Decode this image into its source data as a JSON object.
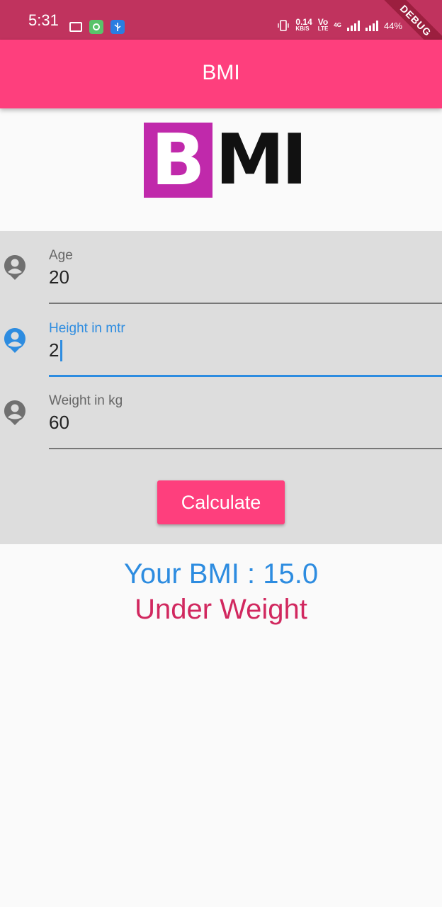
{
  "status_bar": {
    "time": "5:31",
    "speed_value": "0.14",
    "speed_unit": "KB/S",
    "volte_top": "Vo",
    "volte_bottom": "LTE",
    "network": "4G",
    "battery": "44%",
    "debug_label": "DEBUG"
  },
  "app_bar": {
    "title": "BMI"
  },
  "logo": {
    "letter_b": "B",
    "letters_mi": "MI"
  },
  "form": {
    "age": {
      "label": "Age",
      "value": "20"
    },
    "height": {
      "label": "Height in mtr",
      "value": "2"
    },
    "weight": {
      "label": "Weight in kg",
      "value": "60"
    },
    "calculate_label": "Calculate"
  },
  "result": {
    "bmi_text": "Your BMI : 15.0",
    "status_text": "Under Weight"
  },
  "colors": {
    "status_bar": "#c0335e",
    "app_bar": "#fe3f7d",
    "focus_blue": "#2d8ce0",
    "status_red": "#d1285f",
    "logo_magenta": "#c029ab"
  }
}
